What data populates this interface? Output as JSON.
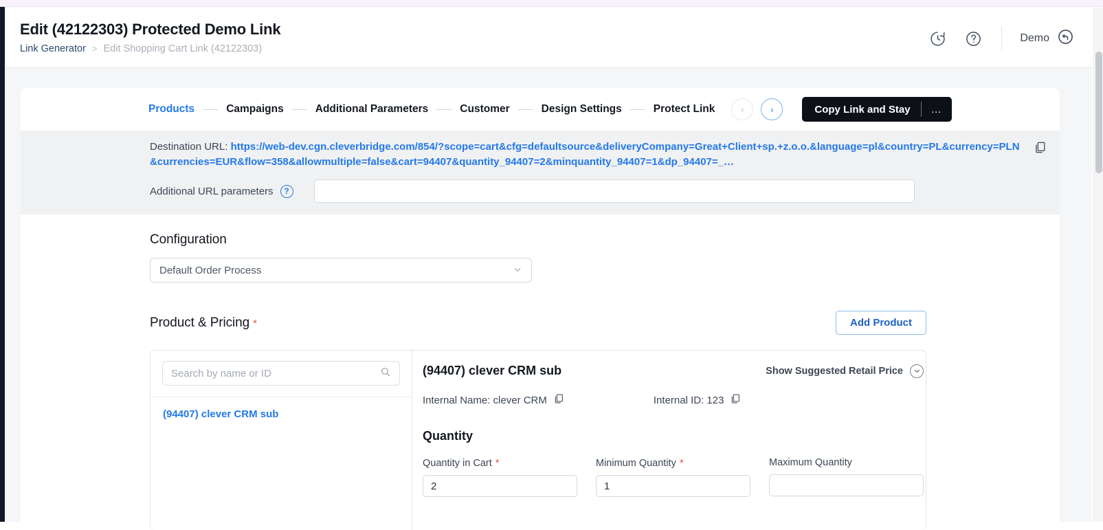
{
  "header": {
    "title": "Edit (42122303) Protected Demo Link",
    "breadcrumb": {
      "root": "Link Generator",
      "separator": ">",
      "current": "Edit Shopping Cart Link (42122303)"
    },
    "history_icon": "history-clock-icon",
    "help_icon": "question-mark-icon",
    "account_label": "Demo",
    "account_icon": "undo-arrow-icon"
  },
  "tabs": [
    {
      "label": "Products",
      "active": true
    },
    {
      "label": "Campaigns",
      "active": false
    },
    {
      "label": "Additional Parameters",
      "active": false
    },
    {
      "label": "Customer",
      "active": false
    },
    {
      "label": "Design Settings",
      "active": false
    },
    {
      "label": "Protect Link",
      "active": false
    }
  ],
  "nav": {
    "prev_icon": "chevron-left-icon",
    "prev_glyph": "‹",
    "next_icon": "chevron-right-icon",
    "next_glyph": "›"
  },
  "primary_action": {
    "label": "Copy Link and Stay",
    "more_glyph": "…"
  },
  "destination": {
    "label": "Destination URL:",
    "url": "https://web-dev.cgn.cleverbridge.com/854/?scope=cart&cfg=defaultsource&deliveryCompany=Great+Client+sp.+z.o.o.&language=pl&country=PL&currency=PLN&currencies=EUR&flow=358&allowmultiple=false&cart=94407&quantity_94407=2&minquantity_94407=1&dp_94407=_…",
    "copy_icon": "copy-icon"
  },
  "additional_params": {
    "label": "Additional URL parameters",
    "help_glyph": "?",
    "value": "",
    "placeholder": ""
  },
  "configuration": {
    "title": "Configuration",
    "selected": "Default Order Process",
    "chevron_glyph": "⌄"
  },
  "product_pricing": {
    "title": "Product & Pricing",
    "required_glyph": "*",
    "add_button": "Add Product"
  },
  "product_list": {
    "search_placeholder": "Search by name or ID",
    "search_value": "",
    "search_icon": "search-icon",
    "items": [
      {
        "label": "(94407) clever CRM sub"
      }
    ]
  },
  "product_detail": {
    "name": "(94407) clever CRM sub",
    "srp_toggle": "Show Suggested Retail Price",
    "srp_chevron_glyph": "⌄",
    "internal_name_label": "Internal Name: clever CRM",
    "internal_id_label": "Internal ID: 123",
    "copy_icon": "copy-icon",
    "quantity_title": "Quantity",
    "fields": [
      {
        "label": "Quantity in Cart",
        "required": true,
        "value": "2"
      },
      {
        "label": "Minimum Quantity",
        "required": true,
        "value": "1"
      },
      {
        "label": "Maximum Quantity",
        "required": false,
        "value": ""
      }
    ]
  },
  "colors": {
    "accent_blue": "#2479e8",
    "dark_button": "#0d1117",
    "required_red": "#e8533f",
    "page_bg": "#f5f6f7"
  }
}
